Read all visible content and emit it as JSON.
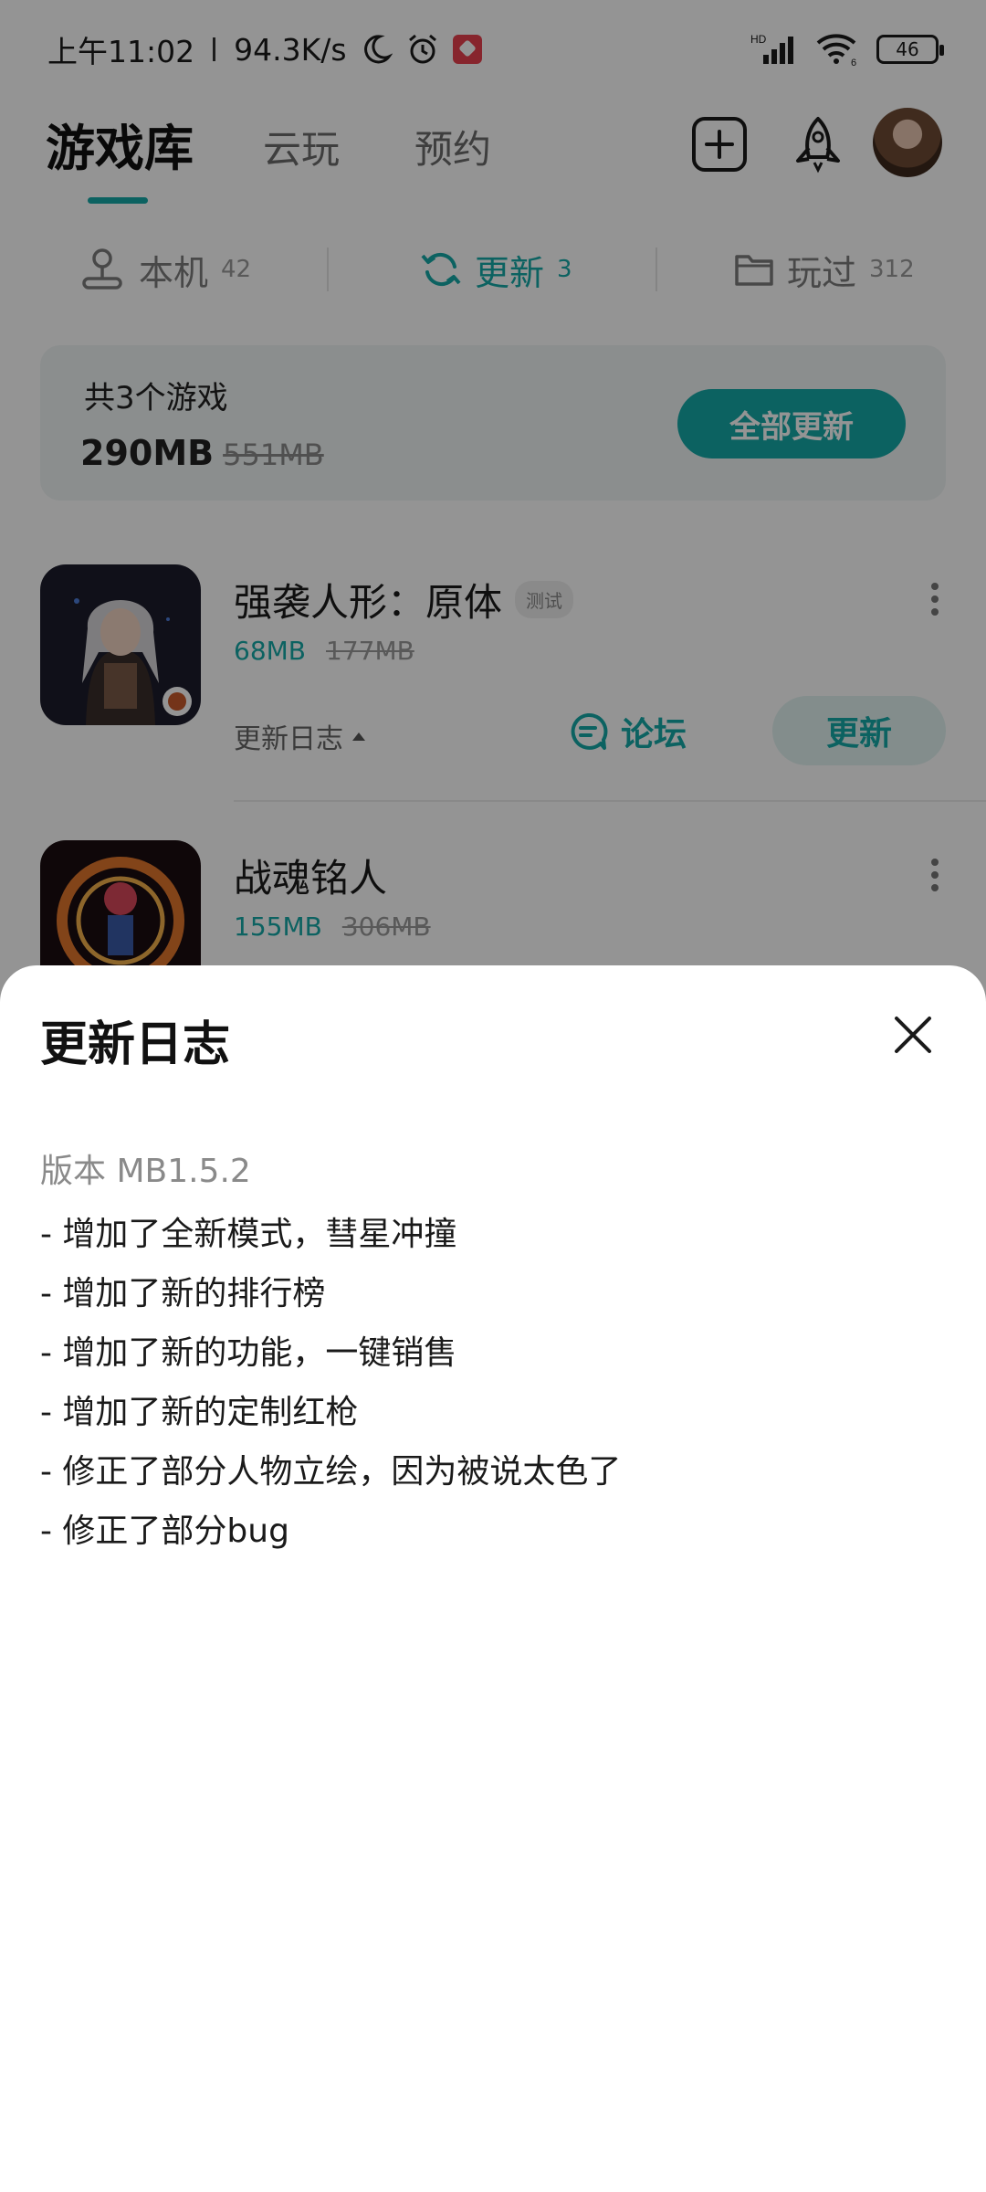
{
  "status_bar": {
    "time": "上午11:02",
    "net_speed": "94.3K/s",
    "network": "HD",
    "wifi_level": "6",
    "battery": "46"
  },
  "top_nav": {
    "tabs": [
      "游戏库",
      "云玩",
      "预约"
    ],
    "active_index": 0,
    "icons": [
      "add-square-icon",
      "rocket-icon",
      "avatar"
    ]
  },
  "sub_tabs": [
    {
      "label": "本机",
      "count": "42",
      "icon": "joystick-icon"
    },
    {
      "label": "更新",
      "count": "3",
      "icon": "refresh-icon",
      "active": true
    },
    {
      "label": "玩过",
      "count": "312",
      "icon": "folder-icon"
    }
  ],
  "summary": {
    "count_text": "共3个游戏",
    "size": "290MB",
    "original_size": "551MB",
    "button": "全部更新"
  },
  "games": [
    {
      "title": "强袭人形：原体",
      "tag": "测试",
      "size": "68MB",
      "original_size": "177MB",
      "changelog_label": "更新日志",
      "forum_label": "论坛",
      "update_label": "更新"
    },
    {
      "title": "战魂铭人",
      "size": "155MB",
      "original_size": "306MB"
    }
  ],
  "sheet": {
    "title": "更新日志",
    "version": "版本  MB1.5.2",
    "notes": [
      "- 增加了全新模式，彗星冲撞",
      "- 增加了新的排行榜",
      "- 增加了新的功能，一键销售",
      "- 增加了新的定制红枪",
      "- 修正了部分人物立绘，因为被说太色了",
      "- 修正了部分bug"
    ]
  },
  "colors": {
    "accent": "#16a9a7",
    "scrim": "rgba(0,0,0,0.42)"
  }
}
